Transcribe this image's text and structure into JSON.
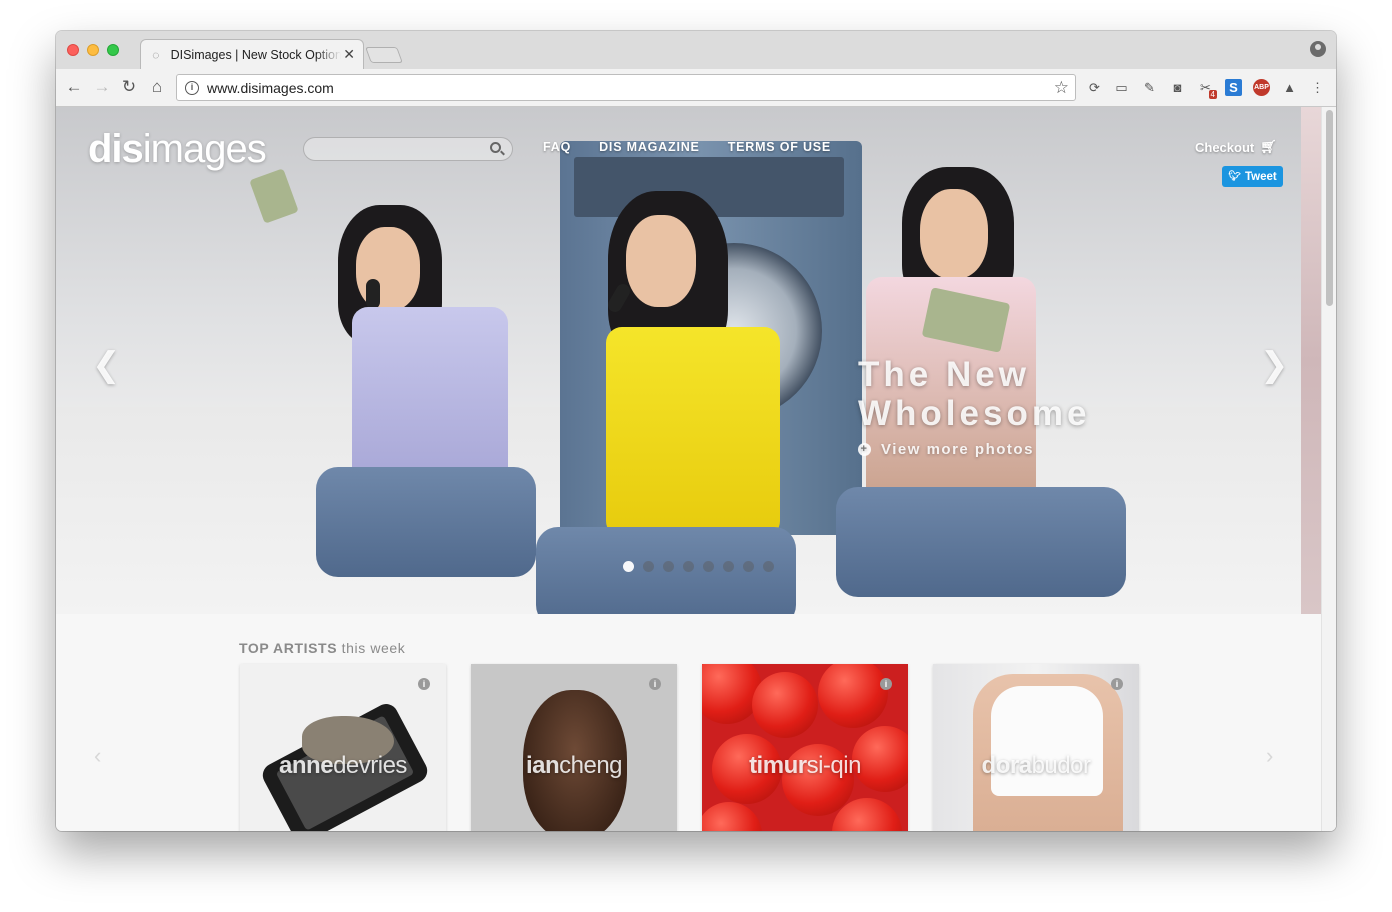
{
  "browser": {
    "tab_title": "DISimages | New Stock Options",
    "url": "www.disimages.com"
  },
  "site": {
    "logo_bold": "dis",
    "logo_light": "images",
    "search_placeholder": "",
    "nav": [
      "FAQ",
      "DIS MAGAZINE",
      "TERMS OF USE"
    ],
    "checkout_label": "Checkout",
    "tweet_label": "Tweet"
  },
  "hero": {
    "title_line1": "The New",
    "title_line2": "Wholesome",
    "cta": "View more photos",
    "slide_count": 8,
    "active_slide": 0
  },
  "artists": {
    "heading_bold": "TOP ARTISTS",
    "heading_rest": "this week",
    "cards": [
      {
        "first": "anne",
        "last": "devries"
      },
      {
        "first": "ian",
        "last": "cheng"
      },
      {
        "first": "timur",
        "last": "si-qin"
      },
      {
        "first": "dora",
        "last": "budor"
      }
    ]
  },
  "colors": {
    "tweet": "#1b95e0",
    "hero_text": "#ffffff"
  }
}
